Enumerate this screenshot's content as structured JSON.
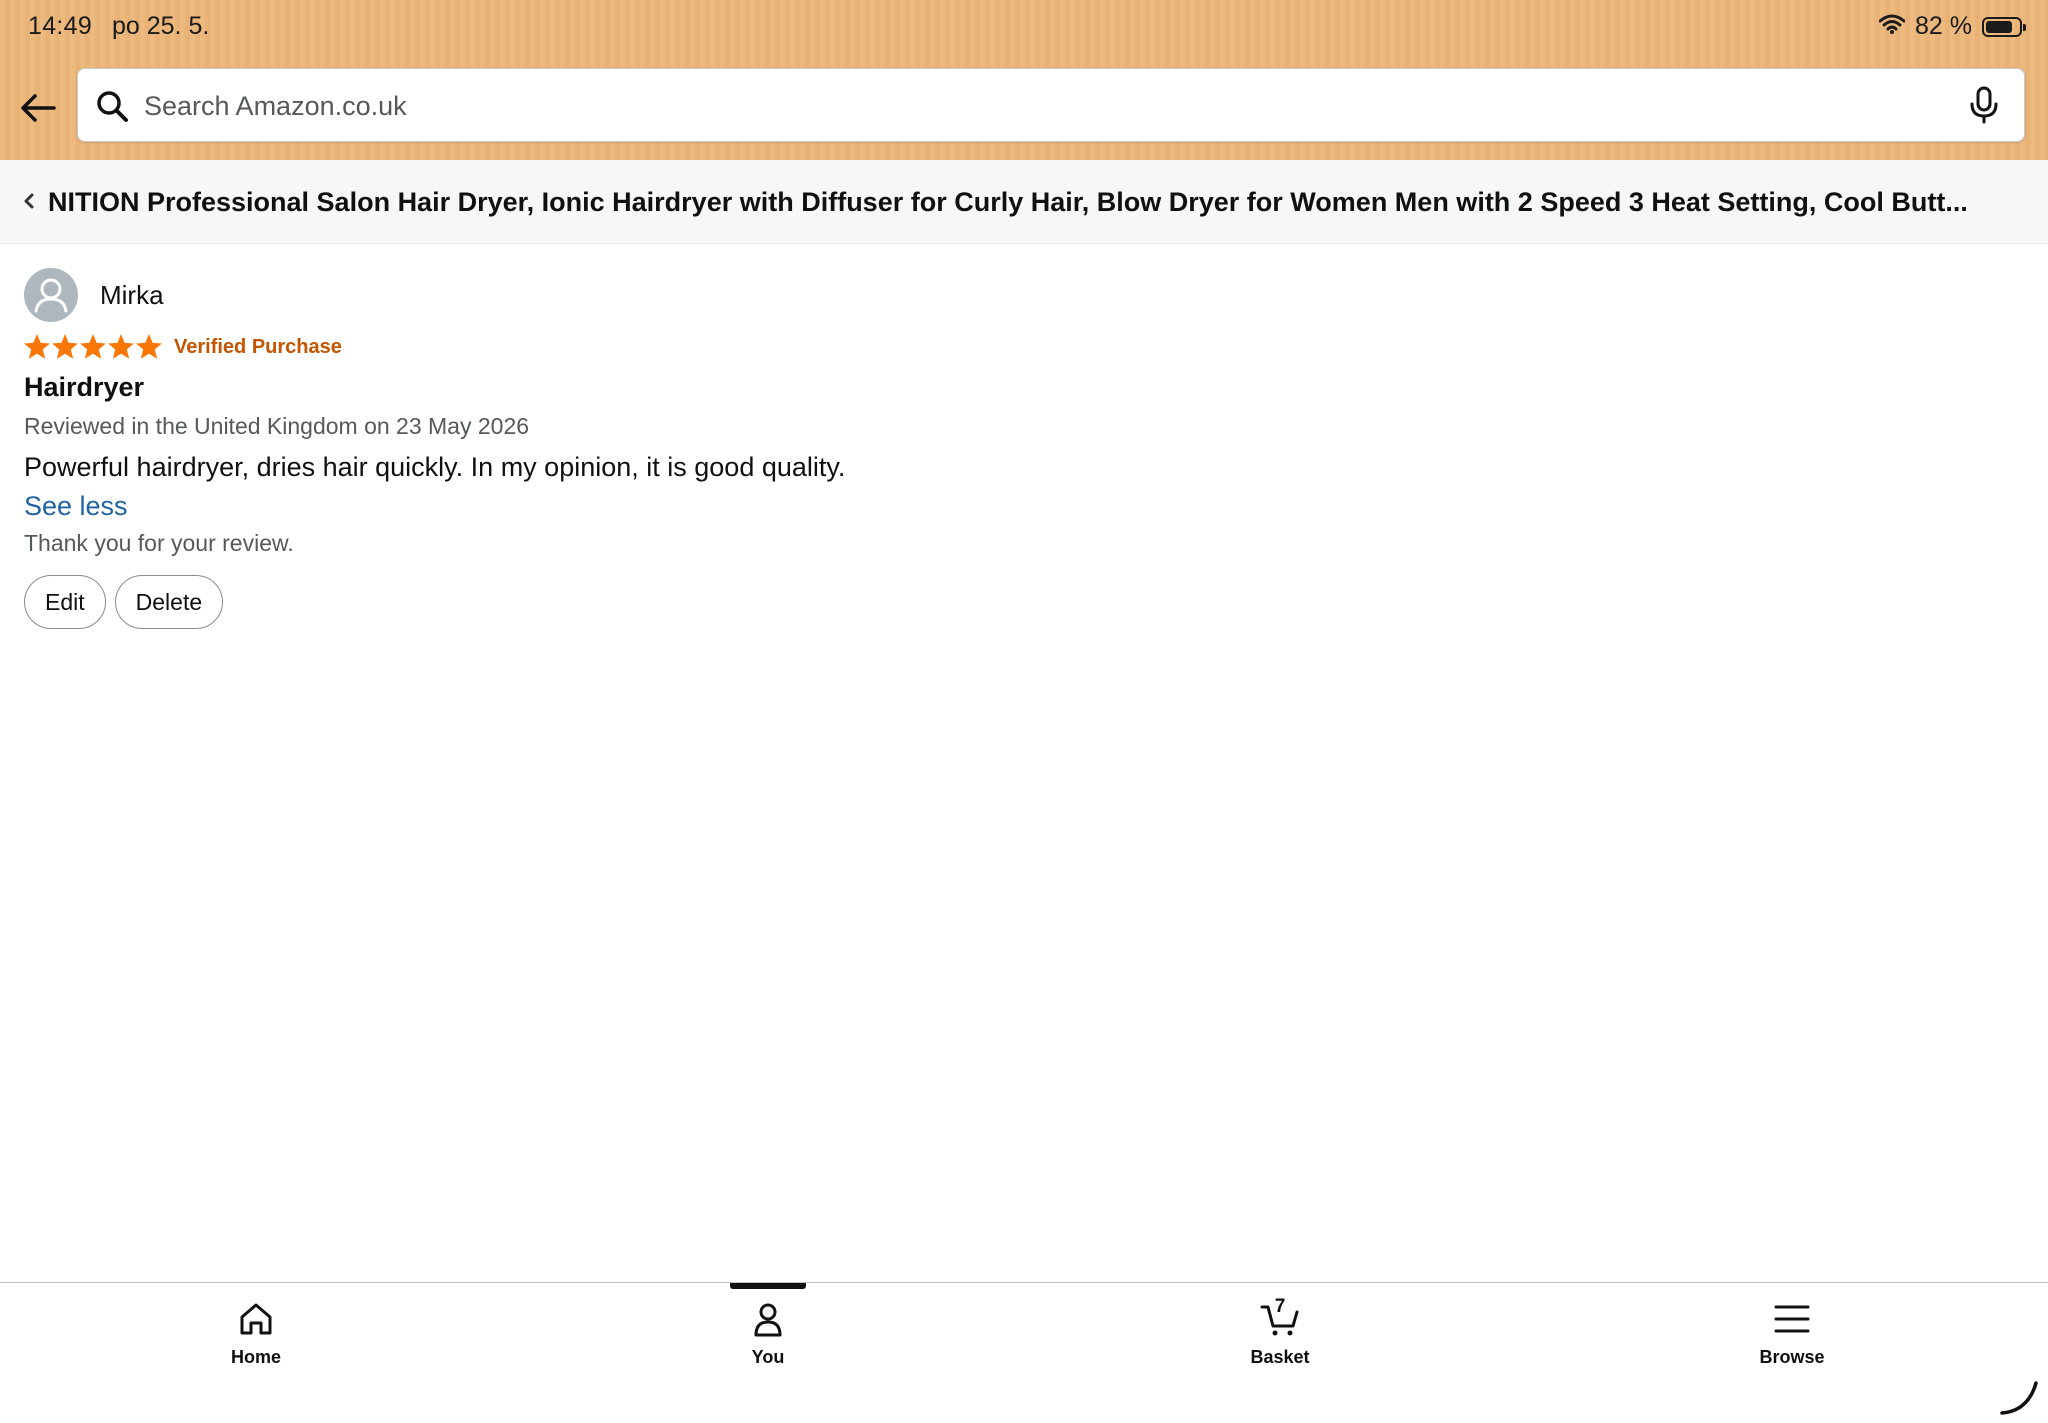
{
  "status_bar": {
    "time": "14:49",
    "date": "po 25. 5.",
    "battery": "82 %",
    "battery_level": 0.82
  },
  "search": {
    "placeholder": "Search Amazon.co.uk",
    "value": ""
  },
  "product": {
    "title": "NITION Professional Salon Hair Dryer, Ionic Hairdryer with Diffuser for Curly Hair, Blow Dryer for Women Men with 2 Speed 3 Heat Setting, Cool Butt..."
  },
  "review": {
    "reviewer_name": "Mirka",
    "rating": 5,
    "rating_max": 5,
    "verified_label": "Verified Purchase",
    "title": "Hairdryer",
    "meta": "Reviewed in the United Kingdom on 23 May 2026",
    "body": "Powerful hairdryer, dries hair quickly. In my opinion, it is good quality.",
    "see_less": "See less",
    "thanks": "Thank you for your review.",
    "edit_label": "Edit",
    "delete_label": "Delete"
  },
  "bottom_nav": {
    "home": "Home",
    "you": "You",
    "basket": "Basket",
    "basket_count": "7",
    "browse": "Browse",
    "active": "You"
  },
  "colors": {
    "header": "#ecba7f",
    "star": "#f97706",
    "verified": "#c45500",
    "link": "#2162a1"
  }
}
